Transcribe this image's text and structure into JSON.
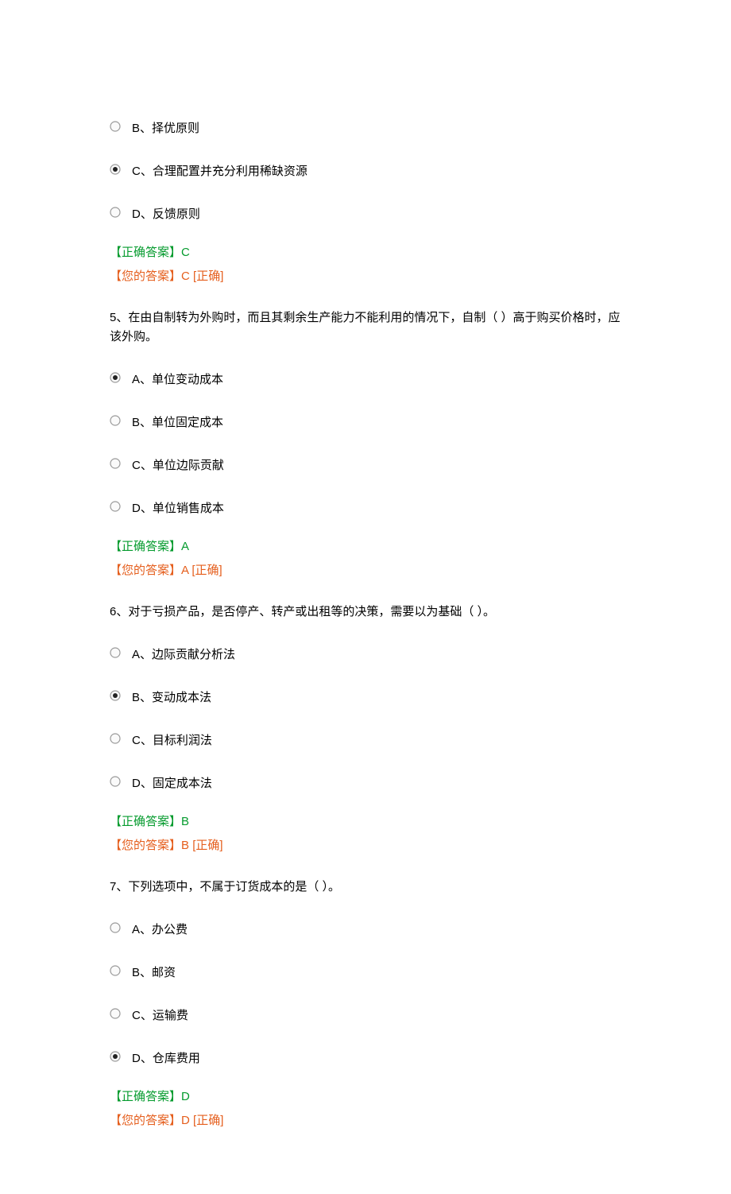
{
  "questions": [
    {
      "prompt": "",
      "options": [
        {
          "letter": "B、",
          "text": "择优原则",
          "selected": false
        },
        {
          "letter": "C、",
          "text": "合理配置并充分利用稀缺资源",
          "selected": true
        },
        {
          "letter": "D、",
          "text": "反馈原则",
          "selected": false
        }
      ],
      "correct_label": "【正确答案】",
      "correct_value": "C",
      "your_label": "【您的答案】",
      "your_value": "C",
      "status": "[正确]"
    },
    {
      "prompt": "5、在由自制转为外购时，而且其剩余生产能力不能利用的情况下，自制（   ）高于购买价格时，应该外购。",
      "options": [
        {
          "letter": "A、",
          "text": "单位变动成本",
          "selected": true
        },
        {
          "letter": "B、",
          "text": "单位固定成本",
          "selected": false
        },
        {
          "letter": "C、",
          "text": "单位边际贡献",
          "selected": false
        },
        {
          "letter": "D、",
          "text": "单位销售成本",
          "selected": false
        }
      ],
      "correct_label": "【正确答案】",
      "correct_value": "A",
      "your_label": "【您的答案】",
      "your_value": "A",
      "status": "[正确]"
    },
    {
      "prompt": "6、对于亏损产品，是否停产、转产或出租等的决策，需要以为基础（   ）。",
      "options": [
        {
          "letter": "A、",
          "text": "边际贡献分析法",
          "selected": false
        },
        {
          "letter": "B、",
          "text": "变动成本法",
          "selected": true
        },
        {
          "letter": "C、",
          "text": "目标利润法",
          "selected": false
        },
        {
          "letter": "D、",
          "text": "固定成本法",
          "selected": false
        }
      ],
      "correct_label": "【正确答案】",
      "correct_value": "B",
      "your_label": "【您的答案】",
      "your_value": "B",
      "status": "[正确]"
    },
    {
      "prompt": "7、下列选项中，不属于订货成本的是（   ）。",
      "options": [
        {
          "letter": "A、",
          "text": "办公费",
          "selected": false
        },
        {
          "letter": "B、",
          "text": "邮资",
          "selected": false
        },
        {
          "letter": "C、",
          "text": "运输费",
          "selected": false
        },
        {
          "letter": "D、",
          "text": "仓库费用",
          "selected": true
        }
      ],
      "correct_label": "【正确答案】",
      "correct_value": "D",
      "your_label": "【您的答案】",
      "your_value": "D",
      "status": "[正确]"
    }
  ]
}
